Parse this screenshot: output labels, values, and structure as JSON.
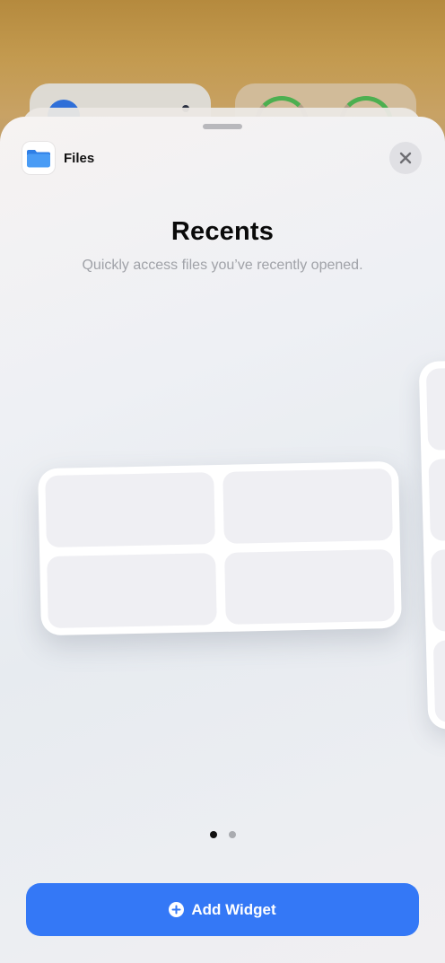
{
  "app": {
    "name": "Files",
    "icon": "folder-icon"
  },
  "widget": {
    "title": "Recents",
    "description": "Quickly access files you’ve recently opened."
  },
  "pagination": {
    "current": 1,
    "total": 2
  },
  "actions": {
    "add_label": "Add Widget",
    "close_icon": "close-icon"
  },
  "colors": {
    "accent": "#3478f6",
    "folder_blue": "#3a8ef0"
  }
}
